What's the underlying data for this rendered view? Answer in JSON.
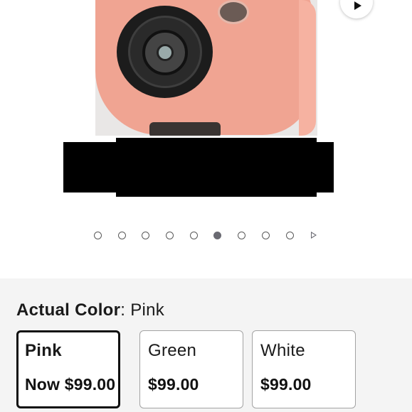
{
  "gallery": {
    "media_icon": "play-icon",
    "pagination": {
      "total_dots": 9,
      "active_index": 5,
      "next_icon": "triangle-right-icon"
    }
  },
  "color_selector": {
    "label_prefix": "Actual Color",
    "label_separator": ":",
    "selected_value": "Pink",
    "options": [
      {
        "name": "Pink",
        "price": "Now $99.00",
        "selected": true
      },
      {
        "name": "Green",
        "price": "$99.00",
        "selected": false
      },
      {
        "name": "White",
        "price": "$99.00",
        "selected": false
      }
    ]
  }
}
